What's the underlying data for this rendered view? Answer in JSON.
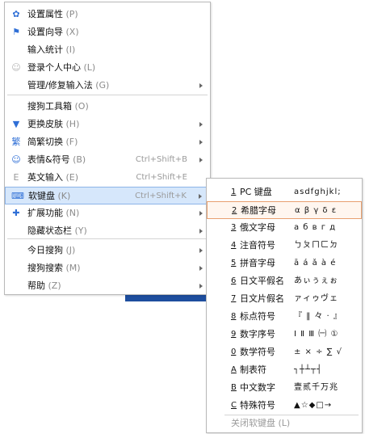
{
  "main_menu": {
    "items": [
      {
        "icon_name": "gear-icon",
        "icon": "✿",
        "icon_color": "#2f6fd6",
        "label": "设置属性",
        "key": "(P)",
        "shortcut": "",
        "arrow": false
      },
      {
        "icon_name": "flag-icon",
        "icon": "⚑",
        "icon_color": "#2f6fd6",
        "label": "设置向导",
        "key": "(X)",
        "shortcut": "",
        "arrow": false
      },
      {
        "icon_name": "",
        "icon": "",
        "icon_color": "",
        "label": "输入统计",
        "key": "(I)",
        "shortcut": "",
        "arrow": false
      },
      {
        "icon_name": "user-icon",
        "icon": "☺",
        "icon_color": "#b5b5b5",
        "label": "登录个人中心",
        "key": "(L)",
        "shortcut": "",
        "arrow": false
      },
      {
        "icon_name": "",
        "icon": "",
        "icon_color": "",
        "label": "管理/修复输入法",
        "key": "(G)",
        "shortcut": "",
        "arrow": true
      },
      {
        "icon_name": "",
        "icon": "",
        "icon_color": "",
        "label": "搜狗工具箱",
        "key": "(O)",
        "shortcut": "",
        "arrow": false
      },
      {
        "icon_name": "shirt-icon",
        "icon": "▼",
        "icon_color": "#2f6fd6",
        "label": "更换皮肤",
        "key": "(H)",
        "shortcut": "",
        "arrow": true
      },
      {
        "icon_name": "simplified-traditional-icon",
        "icon": "繁",
        "icon_color": "#2f6fd6",
        "label": "简繁切换",
        "key": "(F)",
        "shortcut": "",
        "arrow": true
      },
      {
        "icon_name": "emoji-icon",
        "icon": "☺",
        "icon_color": "#2f6fd6",
        "label": "表情&符号",
        "key": "(B)",
        "shortcut": "Ctrl+Shift+B",
        "arrow": true
      },
      {
        "icon_name": "english-input-icon",
        "icon": "E",
        "icon_color": "#9a9a9a",
        "label": "英文输入",
        "key": "(E)",
        "shortcut": "Ctrl+Shift+E",
        "arrow": false
      },
      {
        "icon_name": "keyboard-icon",
        "icon": "⌨",
        "icon_color": "#2f6fd6",
        "label": "软键盘",
        "key": "(K)",
        "shortcut": "Ctrl+Shift+K",
        "arrow": true
      },
      {
        "icon_name": "extension-icon",
        "icon": "✚",
        "icon_color": "#2f6fd6",
        "label": "扩展功能",
        "key": "(N)",
        "shortcut": "",
        "arrow": true
      },
      {
        "icon_name": "",
        "icon": "",
        "icon_color": "",
        "label": "隐藏状态栏",
        "key": "(Y)",
        "shortcut": "",
        "arrow": true
      },
      {
        "icon_name": "",
        "icon": "",
        "icon_color": "",
        "label": "今日搜狗",
        "key": "(J)",
        "shortcut": "",
        "arrow": true
      },
      {
        "icon_name": "",
        "icon": "",
        "icon_color": "",
        "label": "搜狗搜索",
        "key": "(M)",
        "shortcut": "",
        "arrow": true
      },
      {
        "icon_name": "",
        "icon": "",
        "icon_color": "",
        "label": "帮助",
        "key": "(Z)",
        "shortcut": "",
        "arrow": true
      }
    ]
  },
  "soft_keyboard_menu": {
    "items": [
      {
        "num": "1",
        "label": "PC 键盘",
        "sample": "asdfghjkl;"
      },
      {
        "num": "2",
        "label": "希腊字母",
        "sample": "α β γ δ ε"
      },
      {
        "num": "3",
        "label": "俄文字母",
        "sample": "а б в г д"
      },
      {
        "num": "4",
        "label": "注音符号",
        "sample": "ㄅㄆㄇㄈㄉ"
      },
      {
        "num": "5",
        "label": "拼音字母",
        "sample": "ā á ǎ à é"
      },
      {
        "num": "6",
        "label": "日文平假名",
        "sample": "あぃぅぇぉ"
      },
      {
        "num": "7",
        "label": "日文片假名",
        "sample": "ァィゥヴェ"
      },
      {
        "num": "8",
        "label": "标点符号",
        "sample": "『 ‖ 々 · 』"
      },
      {
        "num": "9",
        "label": "数字序号",
        "sample": "Ⅰ Ⅱ Ⅲ ㈠ ①"
      },
      {
        "num": "0",
        "label": "数学符号",
        "sample": "± × ÷ ∑ √"
      },
      {
        "num": "A",
        "label": "制表符",
        "sample": "┐┼┴┬┤"
      },
      {
        "num": "B",
        "label": "中文数字",
        "sample": "壹贰千万兆"
      },
      {
        "num": "C",
        "label": "特殊符号",
        "sample": "▲☆◆□→"
      }
    ],
    "close_label": "关闭软键盘 (L)"
  }
}
